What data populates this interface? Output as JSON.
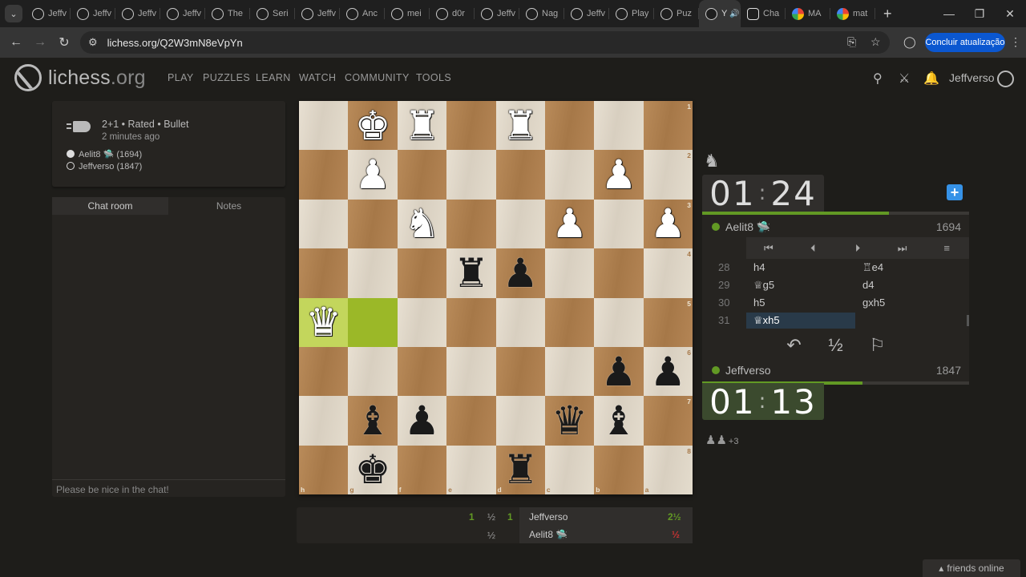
{
  "browser": {
    "tabs": [
      {
        "label": "Jeffv"
      },
      {
        "label": "Jeffv"
      },
      {
        "label": "Jeffv"
      },
      {
        "label": "Jeffv"
      },
      {
        "label": "The"
      },
      {
        "label": "Seri"
      },
      {
        "label": "Jeffv"
      },
      {
        "label": "Anc"
      },
      {
        "label": "mei"
      },
      {
        "label": "d0r"
      },
      {
        "label": "Jeffv"
      },
      {
        "label": "Nag"
      },
      {
        "label": "Jeffv"
      },
      {
        "label": "Play"
      },
      {
        "label": "Puz"
      },
      {
        "label": "Y"
      },
      {
        "label": "Cha"
      },
      {
        "label": "MA"
      },
      {
        "label": "mat"
      }
    ],
    "url": "lichess.org/Q2W3mN8eVpYn",
    "update_label": "Concluir atualização"
  },
  "site": {
    "logo_main": "lichess",
    "logo_tld": ".org",
    "nav": [
      "PLAY",
      "PUZZLES",
      "LEARN",
      "WATCH",
      "COMMUNITY",
      "TOOLS"
    ],
    "username": "Jeffverso"
  },
  "game": {
    "meta": "2+1 • Rated • Bullet",
    "time_ago": "2 minutes ago",
    "white_player": "Aelit8 🛸 (1694)",
    "black_player": "Jeffverso (1847)"
  },
  "chat": {
    "tab_chat": "Chat room",
    "tab_notes": "Notes",
    "input_placeholder": "Please be nice in the chat!"
  },
  "board": {
    "ranks": [
      "1",
      "2",
      "3",
      "4",
      "5",
      "6",
      "7",
      "8"
    ],
    "files": [
      "h",
      "g",
      "f",
      "e",
      "d",
      "c",
      "b",
      "a"
    ],
    "squares": [
      [
        "",
        "wK",
        "wR",
        "",
        "wR",
        "",
        "",
        ""
      ],
      [
        "",
        "wP",
        "",
        "",
        "",
        "",
        "wP",
        ""
      ],
      [
        "",
        "",
        "wN",
        "",
        "",
        "wP",
        "",
        "wP"
      ],
      [
        "",
        "",
        "",
        "bR",
        "bP",
        "",
        "",
        ""
      ],
      [
        "wQ",
        "",
        "",
        "",
        "",
        "",
        "",
        ""
      ],
      [
        "",
        "",
        "",
        "",
        "",
        "",
        "bP",
        "bP"
      ],
      [
        "",
        "bB",
        "bP",
        "",
        "",
        "bQ",
        "bB",
        ""
      ],
      [
        "",
        "bK",
        "",
        "",
        "bR",
        "",
        "",
        ""
      ]
    ]
  },
  "crosstable": {
    "row1_scores": [
      "1",
      "½",
      "1"
    ],
    "row2_scores": [
      "½"
    ],
    "player1": "Jeffverso",
    "player1_total": "2½",
    "player2": "Aelit8 🛸",
    "player2_total": "½"
  },
  "clocks": {
    "top_min": "01",
    "top_sec": "24",
    "bottom_min": "01",
    "bottom_sec": "13",
    "top_fraction": 0.7,
    "bottom_fraction": 0.6
  },
  "opponent": {
    "name": "Aelit8 🛸",
    "rating": "1694"
  },
  "me": {
    "name": "Jeffverso",
    "rating": "1847"
  },
  "moves": [
    {
      "n": "28",
      "w": "h4",
      "b": "♖e4"
    },
    {
      "n": "29",
      "w": "♕g5",
      "b": "d4"
    },
    {
      "n": "30",
      "w": "h5",
      "b": "gxh5"
    },
    {
      "n": "31",
      "w": "♕xh5",
      "b": ""
    }
  ],
  "captured": {
    "pieces": "♟♟",
    "score": "+3"
  },
  "footer": {
    "friends": "friends online"
  },
  "colors": {
    "accent": "#629924",
    "highlight": "#9bb828",
    "blue": "#3692e7"
  }
}
